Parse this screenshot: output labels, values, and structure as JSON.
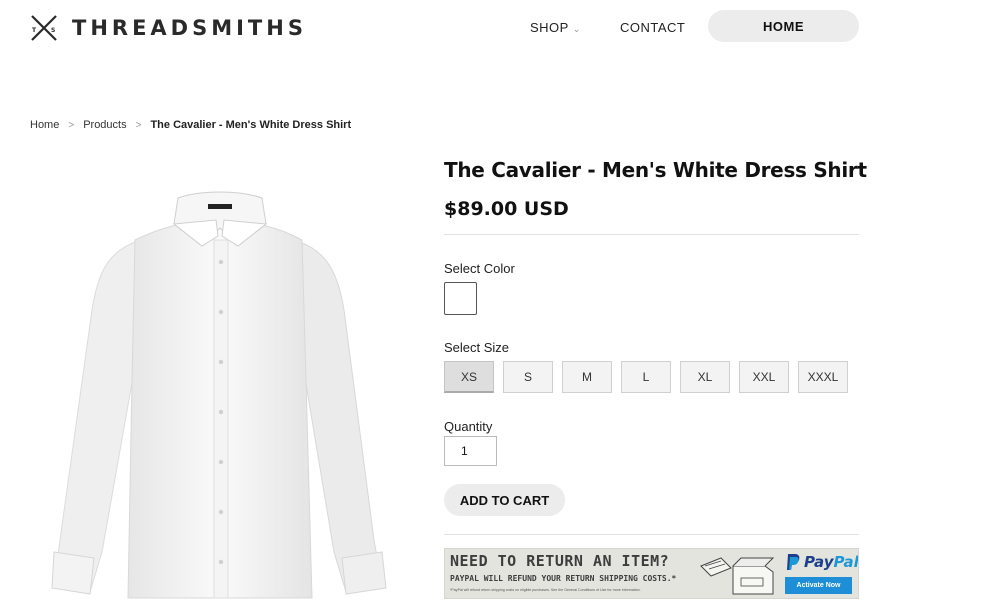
{
  "header": {
    "brand": "THREADSMITHS",
    "logo_letters": "T S",
    "nav": {
      "shop": "SHOP",
      "contact": "CONTACT",
      "home": "HOME"
    }
  },
  "breadcrumb": {
    "items": [
      "Home",
      "Products"
    ],
    "current": "The Cavalier - Men's White Dress Shirt",
    "separator": ">"
  },
  "product": {
    "title": "The Cavalier - Men's White Dress Shirt",
    "price": "$89.00 USD",
    "color_label": "Select Color",
    "selected_color": "#ffffff",
    "size_label": "Select Size",
    "sizes": [
      "XS",
      "S",
      "M",
      "L",
      "XL",
      "XXL",
      "XXXL"
    ],
    "selected_size": "XS",
    "quantity_label": "Quantity",
    "quantity": "1",
    "add_to_cart": "ADD TO CART",
    "image_icon": "white-dress-shirt"
  },
  "banner": {
    "headline": "NEED TO RETURN AN ITEM?",
    "subline": "PAYPAL WILL REFUND YOUR RETURN SHIPPING COSTS.*",
    "fine_print": "*PayPal will refund return shipping costs on eligible purchases. See the General Conditions of Use for more information.",
    "brand_a": "Pay",
    "brand_b": "Pal",
    "activate": "Activate Now"
  },
  "colors": {
    "pill_bg": "#ececec",
    "paypal_dark": "#1b3f8a",
    "paypal_light": "#1d98d6"
  }
}
